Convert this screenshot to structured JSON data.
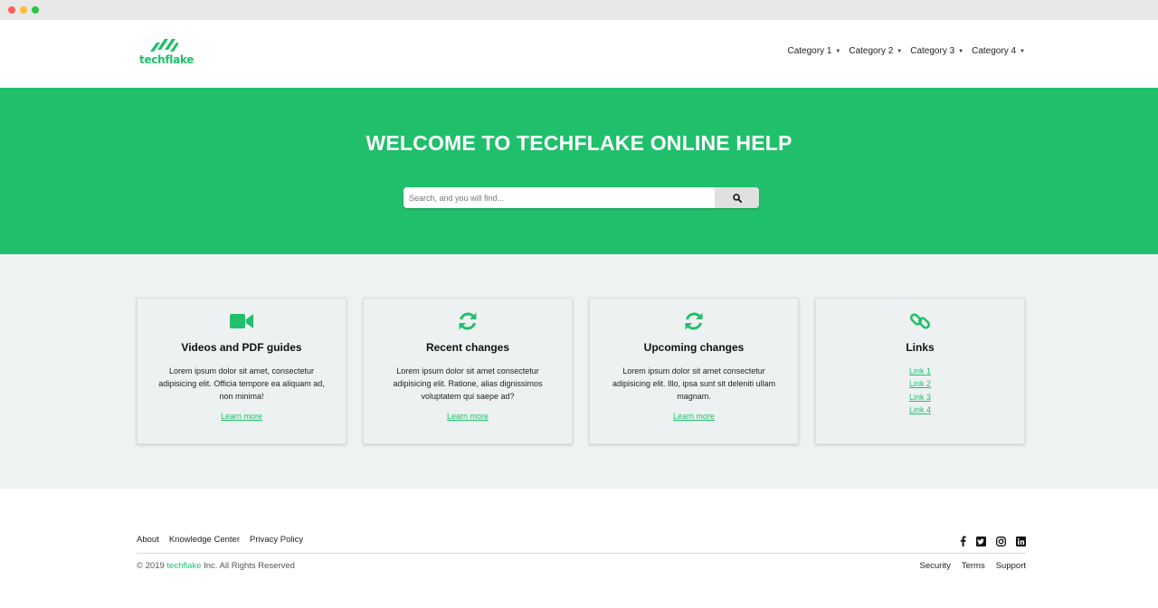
{
  "brand": {
    "name": "techflake",
    "accent": "#20bf6b"
  },
  "nav": {
    "items": [
      {
        "label": "Category 1"
      },
      {
        "label": "Category 2"
      },
      {
        "label": "Category 3"
      },
      {
        "label": "Category 4"
      }
    ]
  },
  "hero": {
    "title": "WELCOME TO TECHFLAKE ONLINE HELP",
    "search_placeholder": "Search, and you will find..."
  },
  "cards": [
    {
      "icon": "video-camera-icon",
      "title": "Videos and PDF guides",
      "text": "Lorem ipsum dolor sit amet, consectetur adipisicing elit. Officia tempore ea aliquam ad, non minima!",
      "link": "Learn more"
    },
    {
      "icon": "refresh-icon",
      "title": "Recent changes",
      "text": "Lorem ipsum dolor sit amet consectetur adipisicing elit. Ratione, alias dignissimos voluptatem qui saepe ad?",
      "link": "Learn more"
    },
    {
      "icon": "refresh-icon",
      "title": "Upcoming changes",
      "text": "Lorem ipsum dolor sit amet consectetur adipisicing elit. Illo, ipsa sunt sit deleniti ullam magnam.",
      "link": "Learn more"
    },
    {
      "icon": "chain-link-icon",
      "title": "Links",
      "links": [
        "Link 1",
        "Link 2",
        "Link 3",
        "Link 4"
      ]
    }
  ],
  "footer": {
    "links": [
      "About",
      "Knowledge Center",
      "Privacy Policy"
    ],
    "social": [
      "facebook-icon",
      "twitter-icon",
      "instagram-icon",
      "linkedin-icon"
    ],
    "copyright_prefix": "© 2019",
    "copyright_brand": "techflake",
    "copyright_suffix": "Inc. All Rights Reserved",
    "bottom_links": [
      "Security",
      "Terms",
      "Support"
    ]
  }
}
